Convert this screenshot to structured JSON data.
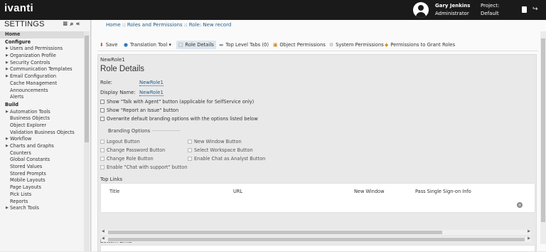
{
  "app": {
    "logo": "ivanti"
  },
  "user": {
    "name": "Gary Jenkins",
    "role": "Administrator",
    "project_label": "Project:",
    "project": "Default"
  },
  "sidebar": {
    "title": "SETTINGS",
    "icons": [
      "filter-icon",
      "search-icon",
      "collapse-icon"
    ],
    "items": [
      {
        "label": "Home",
        "type": "active"
      },
      {
        "label": "Configure",
        "type": "section"
      },
      {
        "label": "Users and Permissions",
        "type": "expandable"
      },
      {
        "label": "Organization Profile",
        "type": "expandable"
      },
      {
        "label": "Security Controls",
        "type": "expandable"
      },
      {
        "label": "Communication Templates",
        "type": "expandable"
      },
      {
        "label": "Email Configuration",
        "type": "expandable"
      },
      {
        "label": "Cache Management",
        "type": "item"
      },
      {
        "label": "Announcements",
        "type": "item"
      },
      {
        "label": "Alerts",
        "type": "item"
      },
      {
        "label": "Build",
        "type": "section"
      },
      {
        "label": "Automation Tools",
        "type": "expandable"
      },
      {
        "label": "Business Objects",
        "type": "item"
      },
      {
        "label": "Object Explorer",
        "type": "item"
      },
      {
        "label": "Validation Business Objects",
        "type": "item"
      },
      {
        "label": "Workflow",
        "type": "expandable"
      },
      {
        "label": "Charts and Graphs",
        "type": "expandable"
      },
      {
        "label": "Counters",
        "type": "item"
      },
      {
        "label": "Global Constants",
        "type": "item"
      },
      {
        "label": "Stored Values",
        "type": "item"
      },
      {
        "label": "Stored Prompts",
        "type": "item"
      },
      {
        "label": "Mobile Layouts",
        "type": "item"
      },
      {
        "label": "Page Layouts",
        "type": "item"
      },
      {
        "label": "Pick Lists",
        "type": "item"
      },
      {
        "label": "Reports",
        "type": "item"
      },
      {
        "label": "Search Tools",
        "type": "expandable"
      }
    ]
  },
  "breadcrumb": "Home :: Roles and Permissions :: Role: New record",
  "toolbar": {
    "save": "Save",
    "translation": "Translation Tool",
    "role_details": "Role Details",
    "top_level_tabs": "Top Level Tabs (0)",
    "object_permissions": "Object Permissions",
    "system_permissions": "System Permissions",
    "grant_roles": "Permissions to Grant Roles"
  },
  "record": {
    "name": "NewRole1",
    "title": "Role Details",
    "role_label": "Role:",
    "role_value": "NewRole1",
    "display_label": "Display Name:",
    "display_value": "NewRole1",
    "checkboxes": [
      "Show \"Talk with Agent\" button (applicable for SelfService only)",
      "Show \"Report an Issue\" button",
      "Overwrite default branding options with the options listed below"
    ],
    "branding_title": "Branding Options",
    "branding_left": [
      "Logout Button",
      "Change Password Button",
      "Change Role Button",
      "Enable \"Chat with support\" button"
    ],
    "branding_right": [
      "New Window Button",
      "Select Workspace Button",
      "Enable Chat as Analyst Button"
    ],
    "top_links_label": "Top Links",
    "top_links_columns": [
      "Title",
      "URL",
      "New Window",
      "Pass Single Sign-on Info"
    ],
    "bottom_links_label": "Bottom Links"
  },
  "colors": {
    "topbar": "#1a1a1a",
    "link": "#1f5d8c",
    "active_tab": "#dde6ee"
  }
}
